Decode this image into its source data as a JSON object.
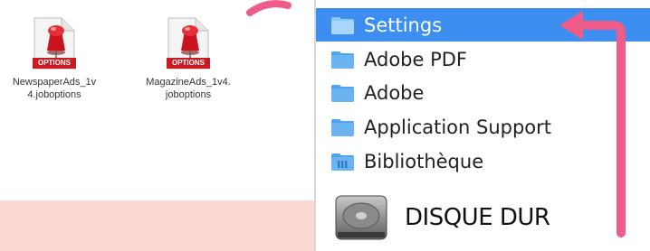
{
  "files": [
    {
      "name_line1": "NewspaperAds_1v",
      "name_line2": "4.joboptions",
      "badge": "OPTIONS",
      "icon": "joboptions-file-icon"
    },
    {
      "name_line1": "MagazineAds_1v4.",
      "name_line2": "joboptions",
      "badge": "OPTIONS",
      "icon": "joboptions-file-icon"
    }
  ],
  "finder": {
    "items": [
      {
        "label": "Settings",
        "icon": "folder-icon",
        "selected": true
      },
      {
        "label": "Adobe PDF",
        "icon": "folder-icon",
        "selected": false
      },
      {
        "label": "Adobe",
        "icon": "folder-icon",
        "selected": false
      },
      {
        "label": "Application Support",
        "icon": "folder-icon",
        "selected": false
      },
      {
        "label": "Bibliothèque",
        "icon": "library-folder-icon",
        "selected": false
      }
    ],
    "disk": {
      "label": "DISQUE DUR",
      "icon": "hard-disk-icon"
    }
  },
  "colors": {
    "selection": "#3c8ef0",
    "folder": "#6cb4f0",
    "arrow": "#ef5c8a",
    "band": "#f9d9d2",
    "pin_red": "#d8202a"
  }
}
